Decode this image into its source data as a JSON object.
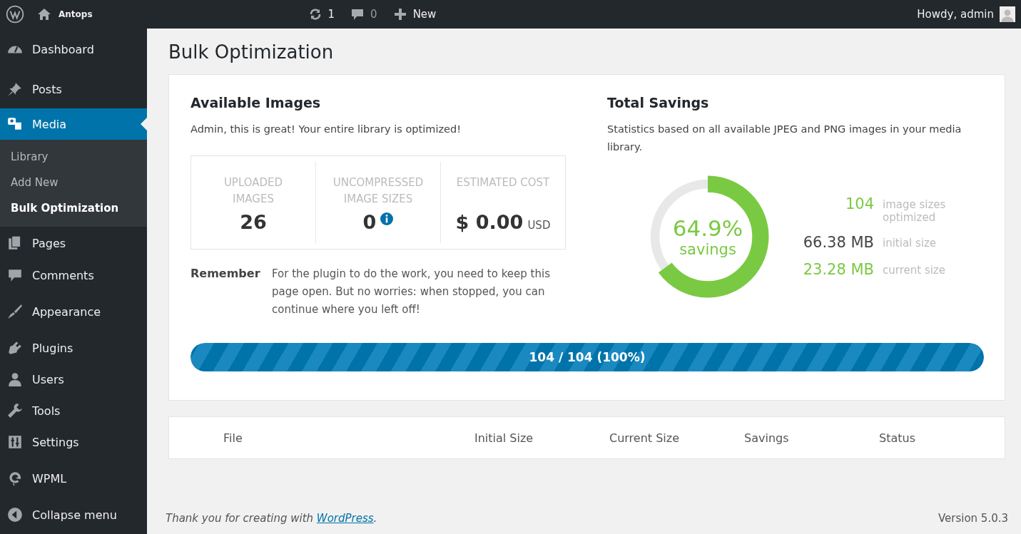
{
  "admin_bar": {
    "site_name": "Antops",
    "updates": "1",
    "comments": "0",
    "new_label": "New",
    "greeting": "Howdy, admin"
  },
  "sidebar": {
    "items": [
      {
        "label": "Dashboard",
        "selected": false
      },
      {
        "label": "Posts",
        "selected": false
      },
      {
        "label": "Media",
        "selected": true,
        "children": [
          {
            "label": "Library",
            "selected": false
          },
          {
            "label": "Add New",
            "selected": false
          },
          {
            "label": "Bulk Optimization",
            "selected": true
          }
        ]
      },
      {
        "label": "Pages",
        "selected": false
      },
      {
        "label": "Comments",
        "selected": false
      },
      {
        "label": "Appearance",
        "selected": false
      },
      {
        "label": "Plugins",
        "selected": false
      },
      {
        "label": "Users",
        "selected": false
      },
      {
        "label": "Tools",
        "selected": false
      },
      {
        "label": "Settings",
        "selected": false
      },
      {
        "label": "WPML",
        "selected": false
      },
      {
        "label": "Collapse menu",
        "selected": false
      }
    ]
  },
  "page_title": "Bulk Optimization",
  "available_images": {
    "title": "Available Images",
    "message": "Admin, this is great! Your entire library is optimized!",
    "stats": [
      {
        "label": "UPLOADED IMAGES",
        "value": "26"
      },
      {
        "label": "UNCOMPRESSED IMAGE SIZES",
        "value": "0",
        "info": true
      },
      {
        "label": "ESTIMATED COST",
        "value": "$ 0.00",
        "unit": "USD"
      }
    ],
    "remember_label": "Remember",
    "remember_text": "For the plugin to do the work, you need to keep this page open. But no worries: when stopped, you can continue where you left off!"
  },
  "total_savings": {
    "title": "Total Savings",
    "description": "Statistics based on all available JPEG and PNG images in your media library.",
    "donut": {
      "level": 0.649,
      "percent": "64.9%",
      "label": "savings"
    },
    "figures": [
      {
        "value": "104",
        "label": "image sizes optimized",
        "color": "#7ac943"
      },
      {
        "value": "66.38 MB",
        "label": "initial size",
        "color": "#444444"
      },
      {
        "value": "23.28 MB",
        "label": "current size",
        "color": "#7ac943"
      }
    ]
  },
  "progress": {
    "level": 1,
    "label": "104 / 104 (100%)"
  },
  "table": {
    "columns": [
      "File",
      "Initial Size",
      "Current Size",
      "Savings",
      "Status"
    ]
  },
  "footer": {
    "text_before": "Thank you for creating with ",
    "link": "WordPress",
    "text_after": ".",
    "version": "Version 5.0.3"
  }
}
